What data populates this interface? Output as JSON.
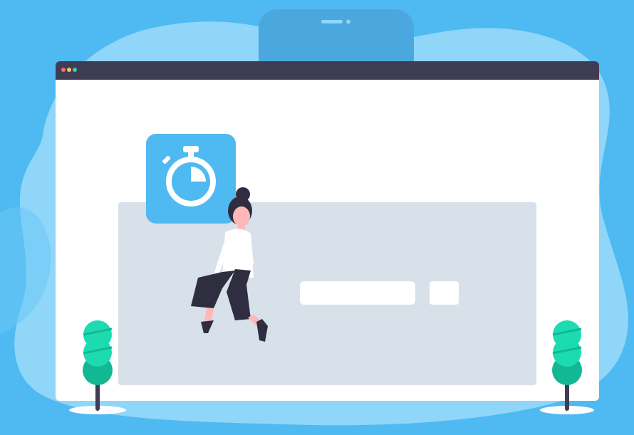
{
  "colors": {
    "background": "#4fb9f2",
    "blob": "#8fd6f9",
    "window": "#ffffff",
    "titlebar": "#3f3d56",
    "panel": "#d8e0ea",
    "accent": "#4fb9f2",
    "plant_light": "#1ddbb0",
    "plant_dark": "#13b893",
    "dot_red": "#f46b6b",
    "dot_yellow": "#f9c74f",
    "dot_green": "#3ad29f"
  },
  "window_controls": [
    "close-dot",
    "minimize-dot",
    "maximize-dot"
  ],
  "timer_tile": {
    "icon": "stopwatch-icon",
    "progress_fraction": 0.25
  },
  "search": {
    "value": "",
    "placeholder": ""
  },
  "search_button": {
    "label": ""
  },
  "decorations": {
    "phone": "phone-icon",
    "person": "person-illustration",
    "plants": [
      "plant-left",
      "plant-right"
    ]
  }
}
